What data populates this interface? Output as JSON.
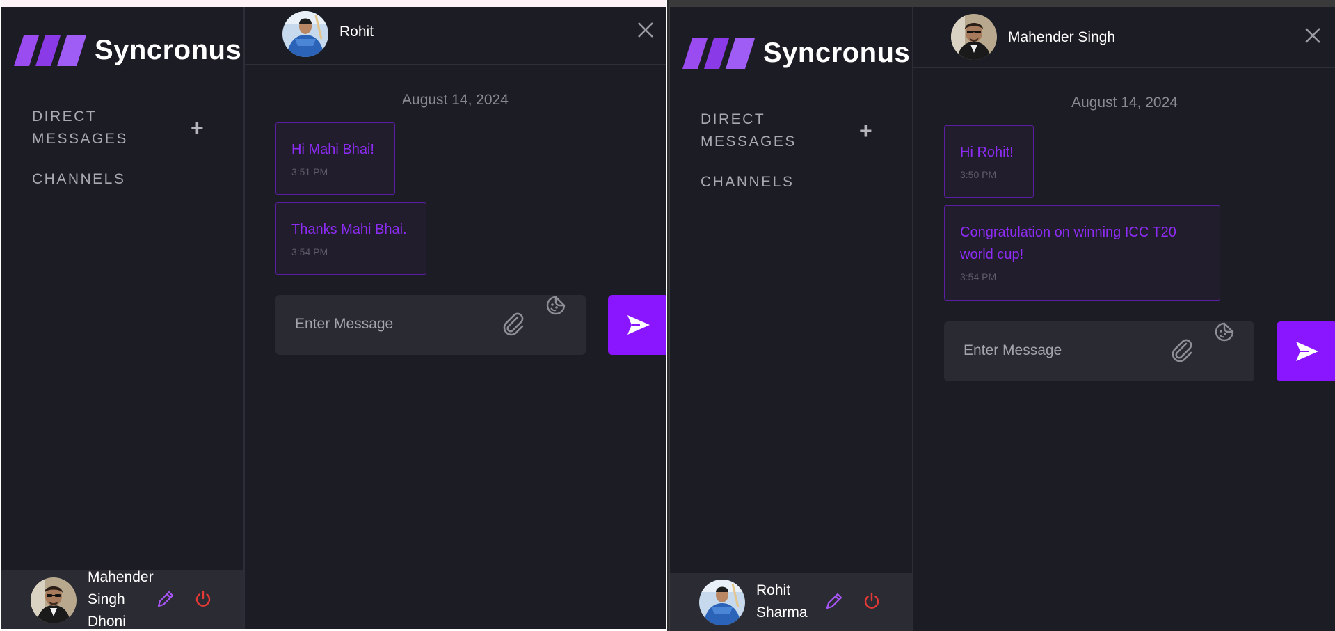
{
  "left_window": {
    "sidebar": {
      "logo_text": "Syncronus",
      "direct_messages_line1": "DIRECT",
      "direct_messages_line2": "MESSAGES",
      "channels": "CHANNELS",
      "profile": {
        "name_line1": "Mahender",
        "name_line2": "Singh",
        "name_line3": "Dhoni"
      }
    },
    "chat": {
      "contact_name": "Rohit",
      "date": "August 14, 2024",
      "messages": [
        {
          "text_lines": [
            "Hi Mahi Bhai!"
          ],
          "time": "3:51 PM"
        },
        {
          "text_lines": [
            "Thanks Mahi Bhai."
          ],
          "time": "3:54 PM"
        }
      ],
      "input_placeholder": "Enter Message"
    }
  },
  "right_window": {
    "sidebar": {
      "logo_text": "Syncronus",
      "direct_messages_line1": "DIRECT",
      "direct_messages_line2": "MESSAGES",
      "channels": "CHANNELS",
      "profile": {
        "name_line1": "Rohit",
        "name_line2": "Sharma"
      }
    },
    "chat": {
      "contact_name": "Mahender Singh",
      "date": "August 14, 2024",
      "messages": [
        {
          "text_lines": [
            "Hi Rohit!"
          ],
          "time": "3:50 PM"
        },
        {
          "text_lines": [
            "Congratulation on winning ICC T20",
            "world cup!"
          ],
          "time": "3:54 PM"
        }
      ],
      "input_placeholder": "Enter Message"
    }
  },
  "colors": {
    "accent": "#8a16ff",
    "message_text": "#8d2cf4",
    "background": "#1c1c24",
    "input_bg": "#2a2a33",
    "logout": "#e53935"
  },
  "icons": [
    "logo-stripes-icon",
    "plus-icon",
    "pencil-icon",
    "power-icon",
    "close-icon",
    "paperclip-icon",
    "emoji-sticker-icon",
    "send-icon"
  ]
}
